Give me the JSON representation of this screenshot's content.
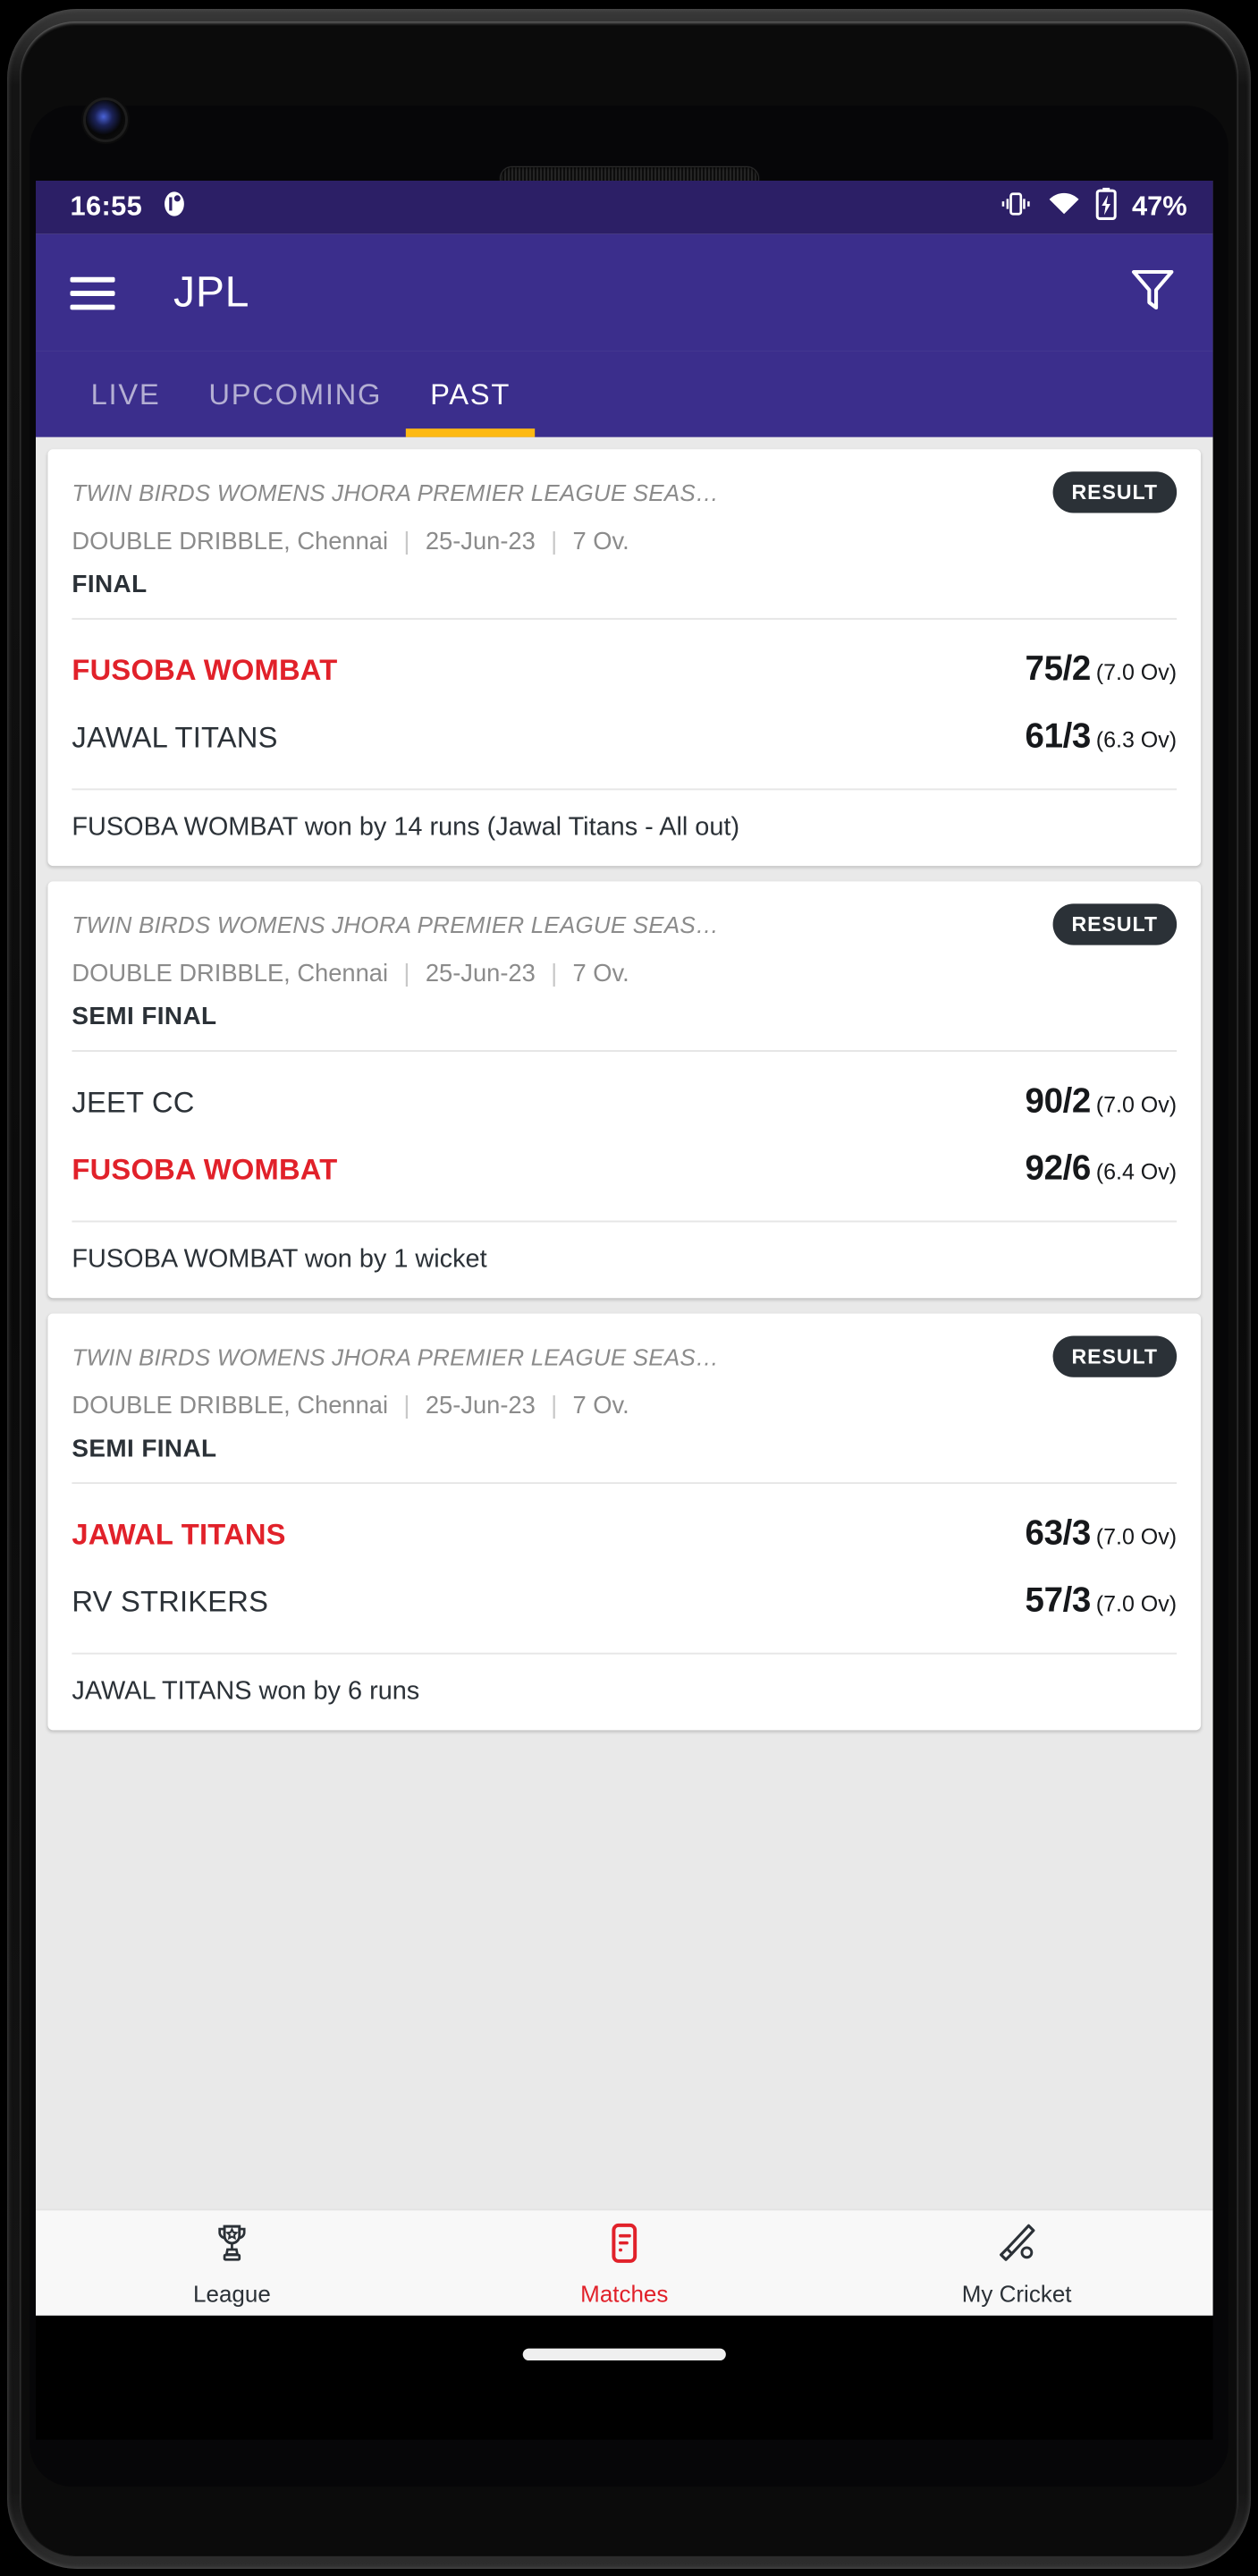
{
  "status_bar": {
    "time": "16:55",
    "notification_icon": "notification-dot-icon",
    "vibrate_icon": "vibrate-icon",
    "wifi_icon": "wifi-icon",
    "battery_icon": "battery-charging-icon",
    "battery_percent": "47%"
  },
  "toolbar": {
    "menu_icon": "hamburger-menu-icon",
    "title": "JPL",
    "filter_icon": "filter-funnel-icon"
  },
  "tabs": [
    {
      "label": "LIVE",
      "active": false
    },
    {
      "label": "UPCOMING",
      "active": false
    },
    {
      "label": "PAST",
      "active": true
    }
  ],
  "colors": {
    "status_bar": "#2c1f66",
    "toolbar": "#3b2e8c",
    "tab_indicator": "#fdb913",
    "winner_red": "#e1212a",
    "badge_dark": "#2b3137",
    "page_background": "#e9e9e9"
  },
  "matches": [
    {
      "tournament": "TWIN BIRDS WOMENS JHORA PREMIER LEAGUE SEAS…",
      "badge": "RESULT",
      "ground": "DOUBLE DRIBBLE, Chennai",
      "date": "25-Jun-23",
      "overs": "7 Ov.",
      "stage": "FINAL",
      "teams": [
        {
          "name": "FUSOBA WOMBAT",
          "winner": true,
          "score": "75/2",
          "overs": "(7.0 Ov)"
        },
        {
          "name": "JAWAL TITANS",
          "winner": false,
          "score": "61/3",
          "overs": "(6.3 Ov)"
        }
      ],
      "result": "FUSOBA WOMBAT won by 14 runs (Jawal Titans - All out)"
    },
    {
      "tournament": "TWIN BIRDS WOMENS JHORA PREMIER LEAGUE SEAS…",
      "badge": "RESULT",
      "ground": "DOUBLE DRIBBLE, Chennai",
      "date": "25-Jun-23",
      "overs": "7 Ov.",
      "stage": "SEMI FINAL",
      "teams": [
        {
          "name": "JEET CC",
          "winner": false,
          "score": "90/2",
          "overs": "(7.0 Ov)"
        },
        {
          "name": "FUSOBA WOMBAT",
          "winner": true,
          "score": "92/6",
          "overs": "(6.4 Ov)"
        }
      ],
      "result": "FUSOBA WOMBAT won by 1 wicket"
    },
    {
      "tournament": "TWIN BIRDS WOMENS JHORA PREMIER LEAGUE SEAS…",
      "badge": "RESULT",
      "ground": "DOUBLE DRIBBLE, Chennai",
      "date": "25-Jun-23",
      "overs": "7 Ov.",
      "stage": "SEMI FINAL",
      "teams": [
        {
          "name": "JAWAL TITANS",
          "winner": true,
          "score": "63/3",
          "overs": "(7.0 Ov)"
        },
        {
          "name": "RV STRIKERS",
          "winner": false,
          "score": "57/3",
          "overs": "(7.0 Ov)"
        }
      ],
      "result": "JAWAL TITANS won by 6 runs"
    }
  ],
  "bottom_nav": [
    {
      "label": "League",
      "icon": "trophy-icon",
      "active": false
    },
    {
      "label": "Matches",
      "icon": "list-card-icon",
      "active": true
    },
    {
      "label": "My Cricket",
      "icon": "cricket-bat-ball-icon",
      "active": false
    }
  ]
}
